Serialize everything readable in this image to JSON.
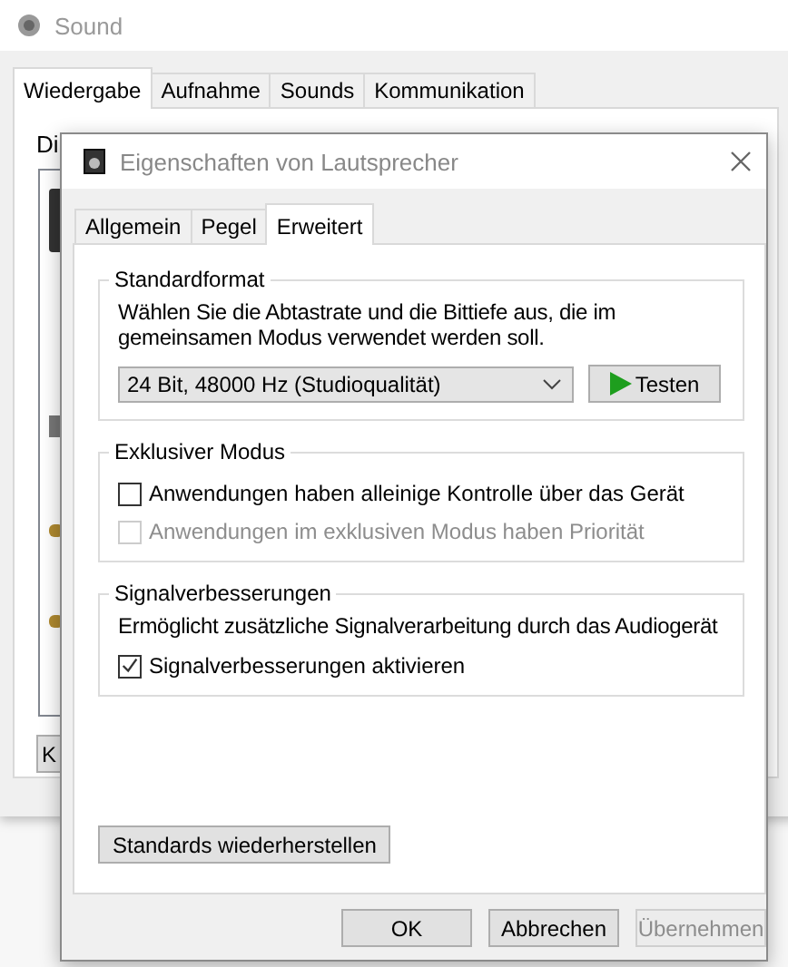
{
  "sound_window": {
    "title": "Sound",
    "tabs": [
      {
        "label": "Wiedergabe",
        "selected": true
      },
      {
        "label": "Aufnahme",
        "selected": false
      },
      {
        "label": "Sounds",
        "selected": false
      },
      {
        "label": "Kommunikation",
        "selected": false
      }
    ],
    "intro": "Di",
    "button": "K"
  },
  "dialog": {
    "title": "Eigenschaften von Lautsprecher",
    "tabs": [
      {
        "label": "Allgemein",
        "selected": false
      },
      {
        "label": "Pegel",
        "selected": false
      },
      {
        "label": "Erweitert",
        "selected": true
      }
    ],
    "standard_format": {
      "title": "Standardformat",
      "description": "Wählen Sie die Abtastrate und die Bittiefe aus, die im gemeinsamen Modus verwendet werden soll.",
      "format": "24 Bit, 48000 Hz (Studioqualität)",
      "test_button": "Testen"
    },
    "exclusive_mode": {
      "title": "Exklusiver Modus",
      "options": [
        {
          "label": "Anwendungen haben alleinige Kontrolle über das Gerät",
          "checked": false,
          "disabled": false
        },
        {
          "label": "Anwendungen im exklusiven Modus haben Priorität",
          "checked": false,
          "disabled": true
        }
      ]
    },
    "enhancements": {
      "title": "Signalverbesserungen",
      "description": "Ermöglicht zusätzliche Signalverarbeitung durch das Audiogerät",
      "options": [
        {
          "label": "Signalverbesserungen aktivieren",
          "checked": true,
          "disabled": false
        }
      ]
    },
    "restore_button": "Standards wiederherstellen",
    "buttons": [
      {
        "label": "OK",
        "disabled": false
      },
      {
        "label": "Abbrechen",
        "disabled": false
      },
      {
        "label": "Übernehmen",
        "disabled": true
      }
    ]
  }
}
